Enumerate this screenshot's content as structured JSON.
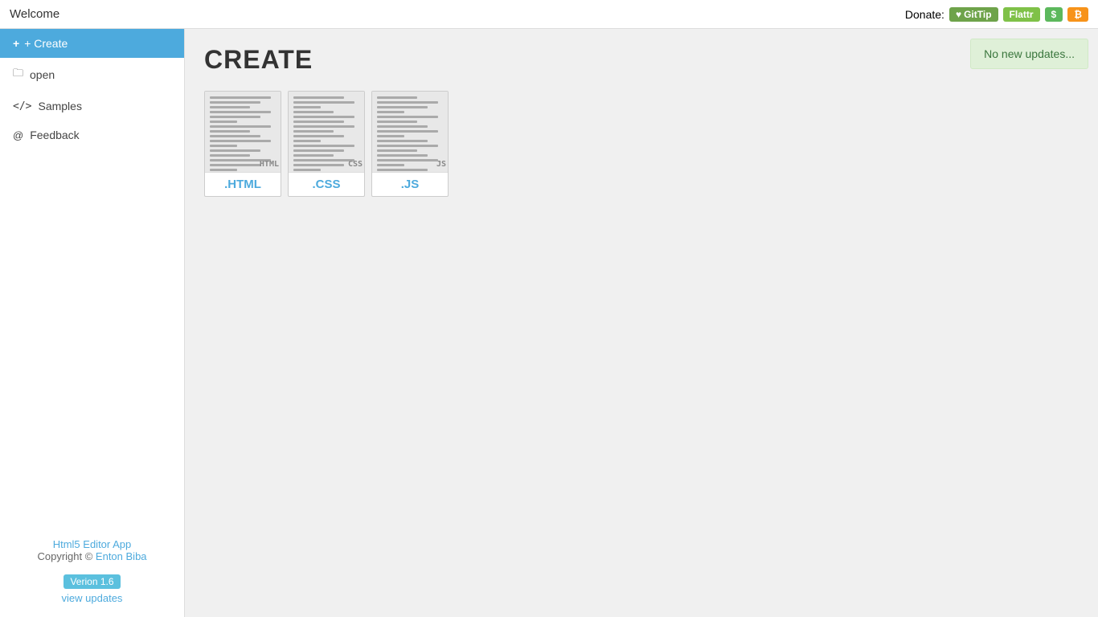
{
  "topbar": {
    "title": "Welcome",
    "donate_label": "Donate:",
    "donate_buttons": [
      {
        "id": "gittip",
        "label": "GitTip",
        "icon": "♥",
        "class": "btn-gittip"
      },
      {
        "id": "flattr",
        "label": "Flattr",
        "icon": "★",
        "class": "btn-flattr"
      },
      {
        "id": "dollar",
        "label": "$",
        "icon": "",
        "class": "btn-dollar"
      },
      {
        "id": "bitcoin",
        "label": "₿",
        "icon": "",
        "class": "btn-bitcoin"
      }
    ]
  },
  "sidebar": {
    "create_label": "+ Create",
    "items": [
      {
        "id": "open",
        "label": "open",
        "icon": "folder"
      },
      {
        "id": "samples",
        "label": "Samples",
        "icon": "code"
      },
      {
        "id": "feedback",
        "label": "Feedback",
        "icon": "at"
      }
    ],
    "footer": {
      "app_name": "Html5 Editor App",
      "copyright": "Copyright ©",
      "author": "Enton Biba",
      "version_label": "Verion 1.6",
      "view_updates": "view updates"
    }
  },
  "main": {
    "title": "CREATE",
    "no_updates_text": "No new updates...",
    "file_types": [
      {
        "id": "html",
        "label": ".HTML",
        "tag": "HTML"
      },
      {
        "id": "css",
        "label": ".CSS",
        "tag": "CSS"
      },
      {
        "id": "js",
        "label": ".JS",
        "tag": "JS"
      }
    ]
  }
}
